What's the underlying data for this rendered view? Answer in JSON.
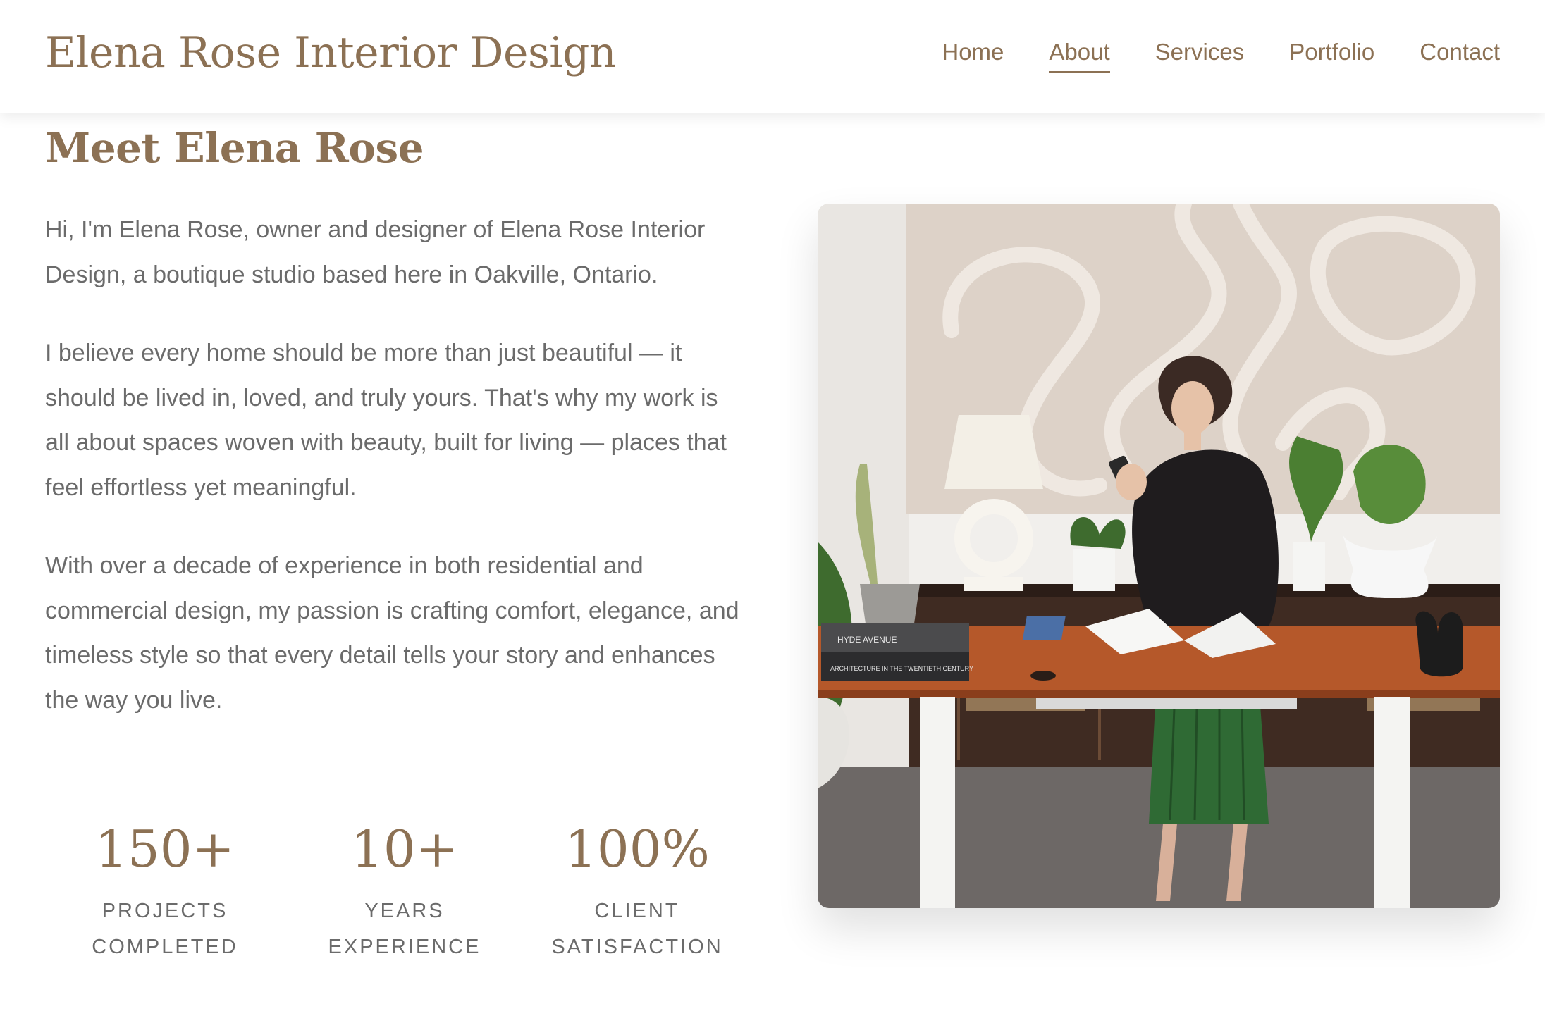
{
  "header": {
    "brand": "Elena Rose Interior Design",
    "nav": [
      {
        "label": "Home",
        "active": false
      },
      {
        "label": "About",
        "active": true
      },
      {
        "label": "Services",
        "active": false
      },
      {
        "label": "Portfolio",
        "active": false
      },
      {
        "label": "Contact",
        "active": false
      }
    ]
  },
  "about": {
    "heading": "Meet Elena Rose",
    "paragraphs": [
      "Hi, I'm Elena Rose, owner and designer of Elena Rose Interior Design, a boutique studio based here in Oakville, Ontario.",
      "I believe every home should be more than just beautiful — it should be lived in, loved, and truly yours. That's why my work is all about spaces woven with beauty, built for living — places that feel effortless yet meaningful.",
      "With over a decade of experience in both residential and commercial design, my passion is crafting comfort, elegance, and timeless style so that every detail tells your story and enhances the way you live."
    ],
    "stats": [
      {
        "value": "150+",
        "label_line1": "PROJECTS",
        "label_line2": "COMPLETED"
      },
      {
        "value": "10+",
        "label_line1": "YEARS",
        "label_line2": "EXPERIENCE"
      },
      {
        "value": "100%",
        "label_line1": "CLIENT",
        "label_line2": "SATISFACTION"
      }
    ],
    "photo_book_labels": {
      "book1": "HYDE AVENUE",
      "book2": "ARCHITECTURE IN THE TWENTIETH CENTURY"
    }
  },
  "colors": {
    "accent": "#8c7154",
    "body_text": "#6b6b6b",
    "background": "#ffffff"
  }
}
